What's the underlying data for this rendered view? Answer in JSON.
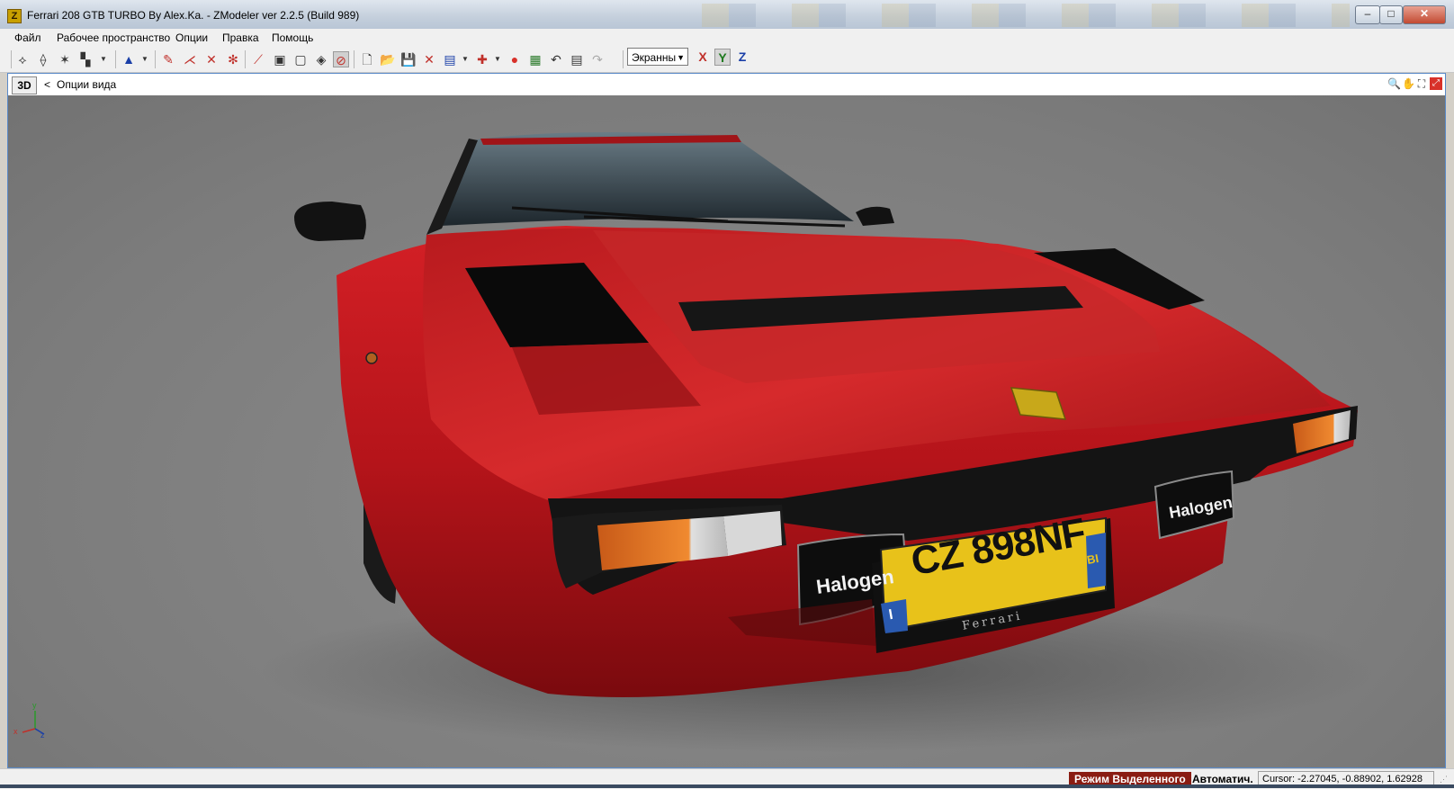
{
  "window": {
    "title": "Ferrari 208 GTB TURBO By Alex.Ka. - ZModeler ver 2.2.5 (Build 989)",
    "app_icon": "Z",
    "controls": {
      "minimize": "‒",
      "maximize": "□",
      "close": "✕"
    }
  },
  "menu": {
    "items": [
      {
        "label": "Файл"
      },
      {
        "label": "Рабочее пространство"
      },
      {
        "label": "Опции"
      },
      {
        "label": "Правка"
      },
      {
        "label": "Помощь"
      }
    ]
  },
  "toolbar": {
    "screen_mode": "Экранны",
    "axis": {
      "x": "X",
      "y": "Y",
      "z": "Z"
    }
  },
  "viewport": {
    "mode_label": "3D",
    "back_arrow": "<",
    "title": "Опции вида"
  },
  "plate": {
    "text": "CZ 898NF",
    "country": "I",
    "province": "BI",
    "frame_text": "Ferrari"
  },
  "fog_lights": {
    "brand": "Halogen"
  },
  "gizmo": {
    "x": "x",
    "y": "y",
    "z": "z"
  },
  "status": {
    "mode": "Режим Выделенного",
    "auto": "Автоматич.",
    "cursor": "Cursor: -2.27045, -0.88902, 1.62928"
  },
  "colors": {
    "car_red": "#c2161a",
    "viewport_bg": "#808080",
    "status_mode_bg": "#8a1c12",
    "plate_yellow": "#e8c21a"
  }
}
